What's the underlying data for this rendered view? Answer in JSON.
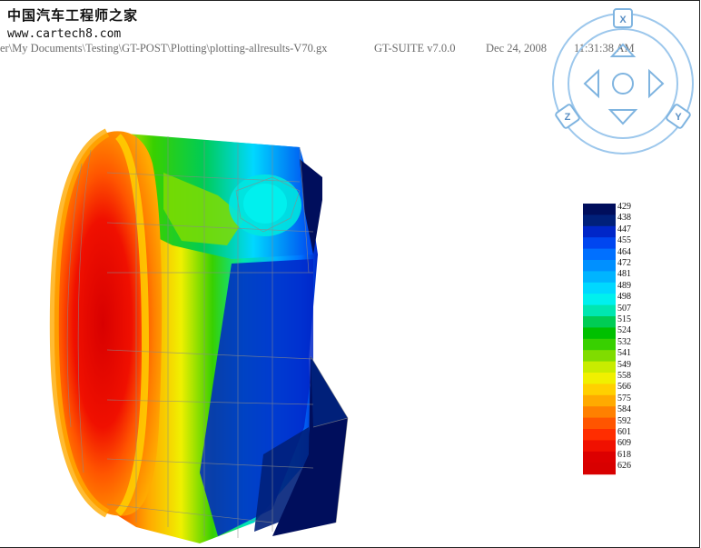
{
  "watermark": {
    "site_name_cn": "中国汽车工程师之家",
    "site_url": "www.cartech8.com"
  },
  "header": {
    "file_path": "er\\My Documents\\Testing\\GT-POST\\Plotting\\plotting-allresults-V70.gx",
    "version": "GT-SUITE v7.0.0",
    "date": "Dec 24, 2008",
    "time": "11:31:38 AM"
  },
  "navigator": {
    "x_label": "X",
    "y_label": "Y",
    "z_label": "Z"
  },
  "legend": {
    "values": [
      "429",
      "438",
      "447",
      "455",
      "464",
      "472",
      "481",
      "489",
      "498",
      "507",
      "515",
      "524",
      "532",
      "541",
      "549",
      "558",
      "566",
      "575",
      "584",
      "592",
      "601",
      "609",
      "618",
      "626"
    ],
    "colors": [
      "#000e5c",
      "#00207a",
      "#0026c8",
      "#0046f0",
      "#0070ff",
      "#0090ff",
      "#00b4ff",
      "#00d8ff",
      "#00f0ee",
      "#00e6b0",
      "#00cc55",
      "#00c000",
      "#38d000",
      "#80dc00",
      "#c8ec00",
      "#f0f000",
      "#ffd000",
      "#ffaa00",
      "#ff8000",
      "#ff5500",
      "#ff2d00",
      "#f01000",
      "#dc0000",
      "#d80000"
    ]
  }
}
